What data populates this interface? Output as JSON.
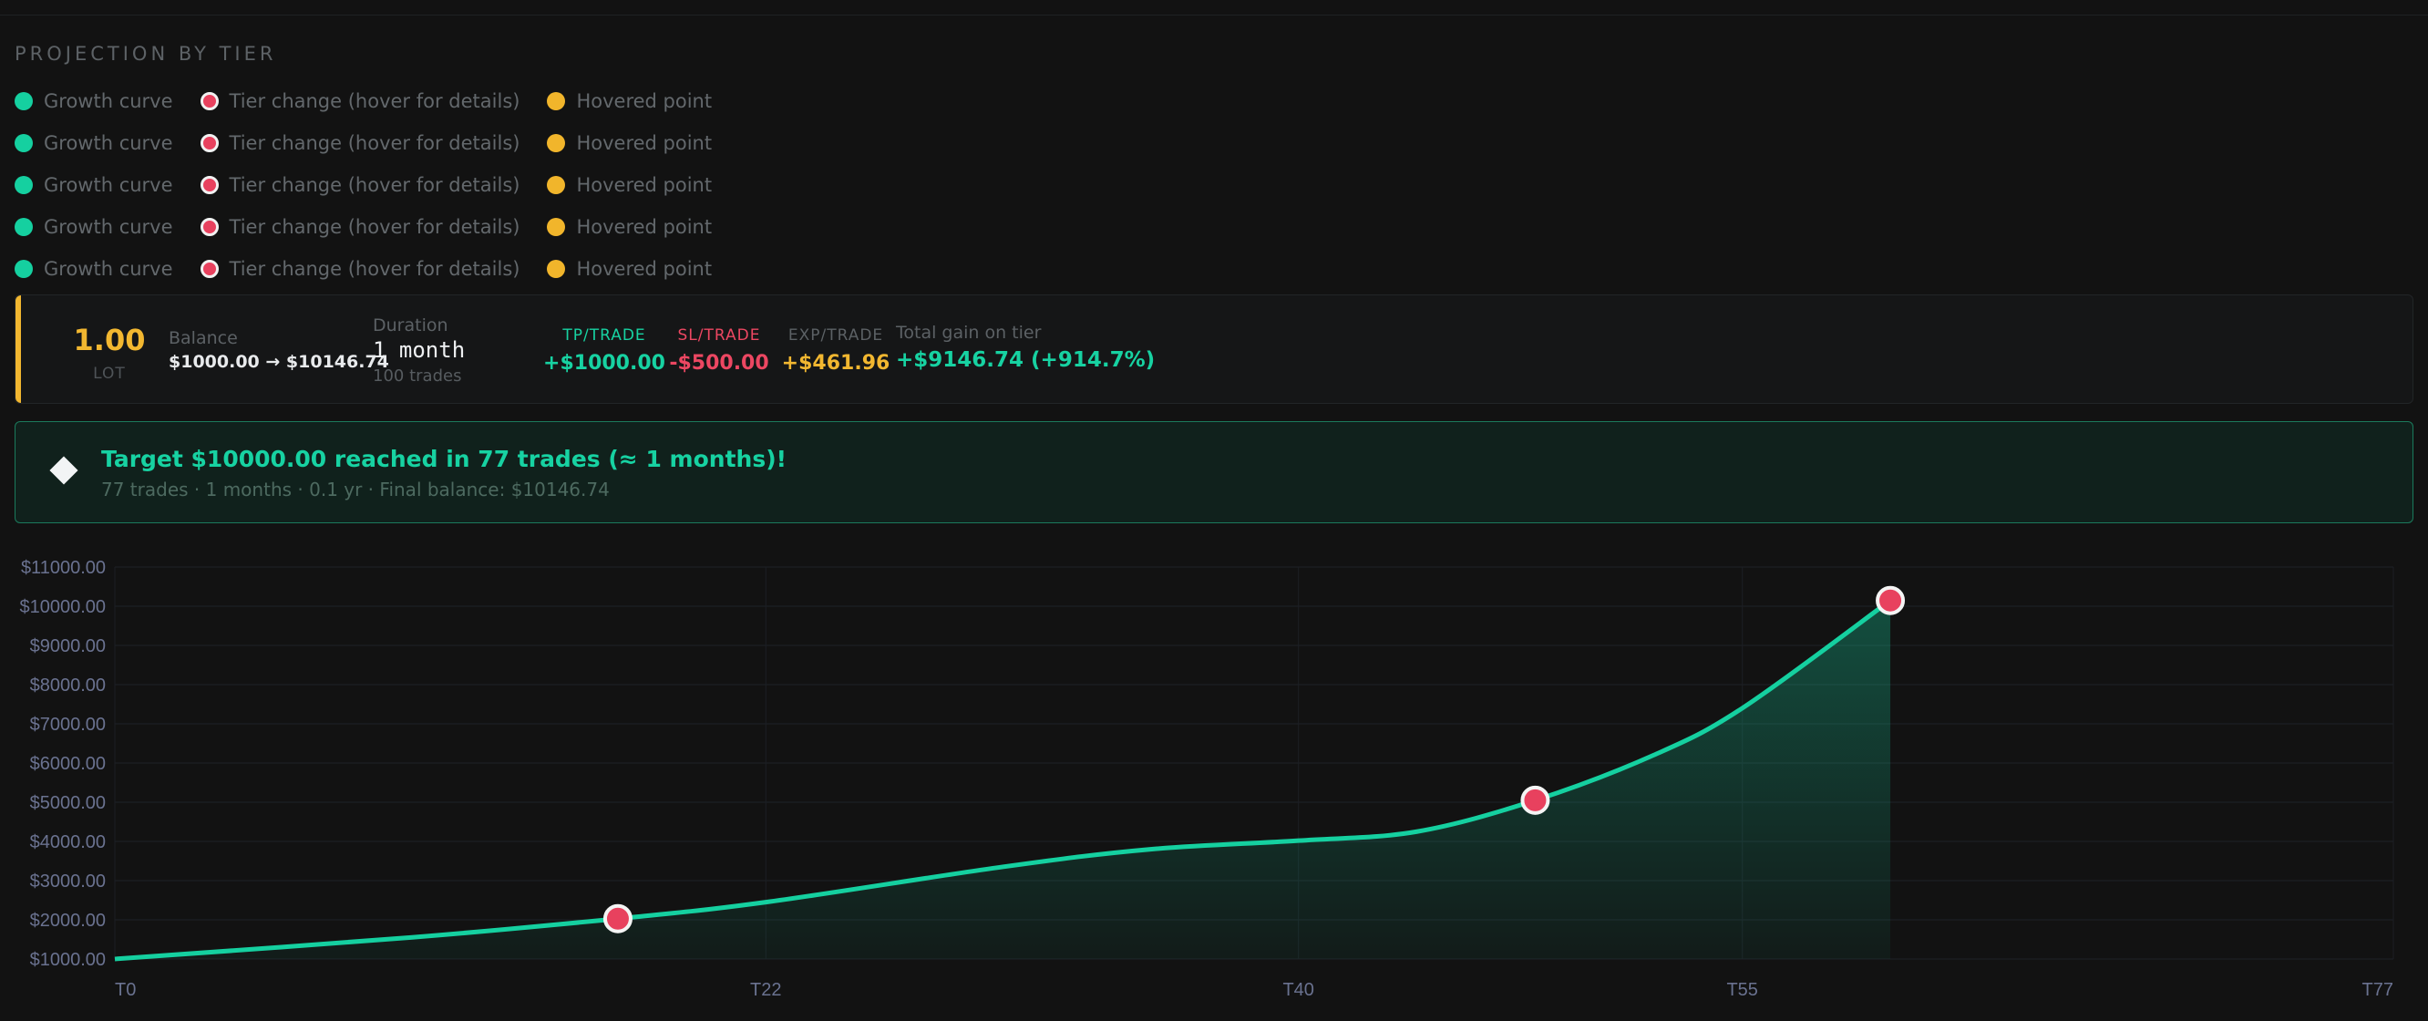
{
  "section": {
    "title": "PROJECTION BY TIER"
  },
  "legend": {
    "growth_label": "Growth curve",
    "tier_label": "Tier change (hover for details)",
    "hover_label": "Hovered point",
    "rows": 5
  },
  "tier": {
    "lot_value": "1.00",
    "lot_label": "LOT",
    "balance_label": "Balance",
    "balance_value": "$1000.00 → $10146.74",
    "duration_label": "Duration",
    "duration_value": "1 month",
    "duration_trades": "100 trades",
    "tp_label": "TP/TRADE",
    "tp_value": "+$1000.00",
    "sl_label": "SL/TRADE",
    "sl_value": "-$500.00",
    "exp_label": "EXP/TRADE",
    "exp_value": "+$461.96",
    "gain_label": "Total gain on tier",
    "gain_value": "+$9146.74 (+914.7%)"
  },
  "banner": {
    "title": "Target $10000.00 reached in 77 trades (≈ 1 months)!",
    "subtitle": "77 trades · 1 months · 0.1 yr · Final balance: $10146.74"
  },
  "colors": {
    "growth": "#15d0a0",
    "tier_change": "#e8415e",
    "hovered": "#f1b52b",
    "accent": "#f2b730"
  },
  "chart_data": {
    "type": "area",
    "y_ticks": [
      "$1000.00",
      "$2000.00",
      "$3000.00",
      "$4000.00",
      "$5000.00",
      "$6000.00",
      "$7000.00",
      "$8000.00",
      "$9000.00",
      "$10000.00",
      "$11000.00"
    ],
    "ylim": [
      1000,
      11000
    ],
    "x_ticks": [
      {
        "label": "T0",
        "value": 0
      },
      {
        "label": "T22",
        "value": 22
      },
      {
        "label": "T40",
        "value": 40
      },
      {
        "label": "T55",
        "value": 55
      },
      {
        "label": "T77",
        "value": 77
      }
    ],
    "xlim": [
      0,
      77
    ],
    "series": [
      {
        "x": [
          0,
          10,
          17,
          22,
          30,
          35,
          40,
          44,
          48,
          52,
          55,
          60
        ],
        "y": [
          1000,
          1550,
          2030,
          2450,
          3350,
          3800,
          4020,
          4250,
          5050,
          6200,
          7400,
          10146.74
        ]
      }
    ],
    "tier_changes": [
      {
        "x": 17,
        "y": 2030
      },
      {
        "x": 48,
        "y": 5050
      },
      {
        "x": 60,
        "y": 10146.74
      }
    ]
  }
}
